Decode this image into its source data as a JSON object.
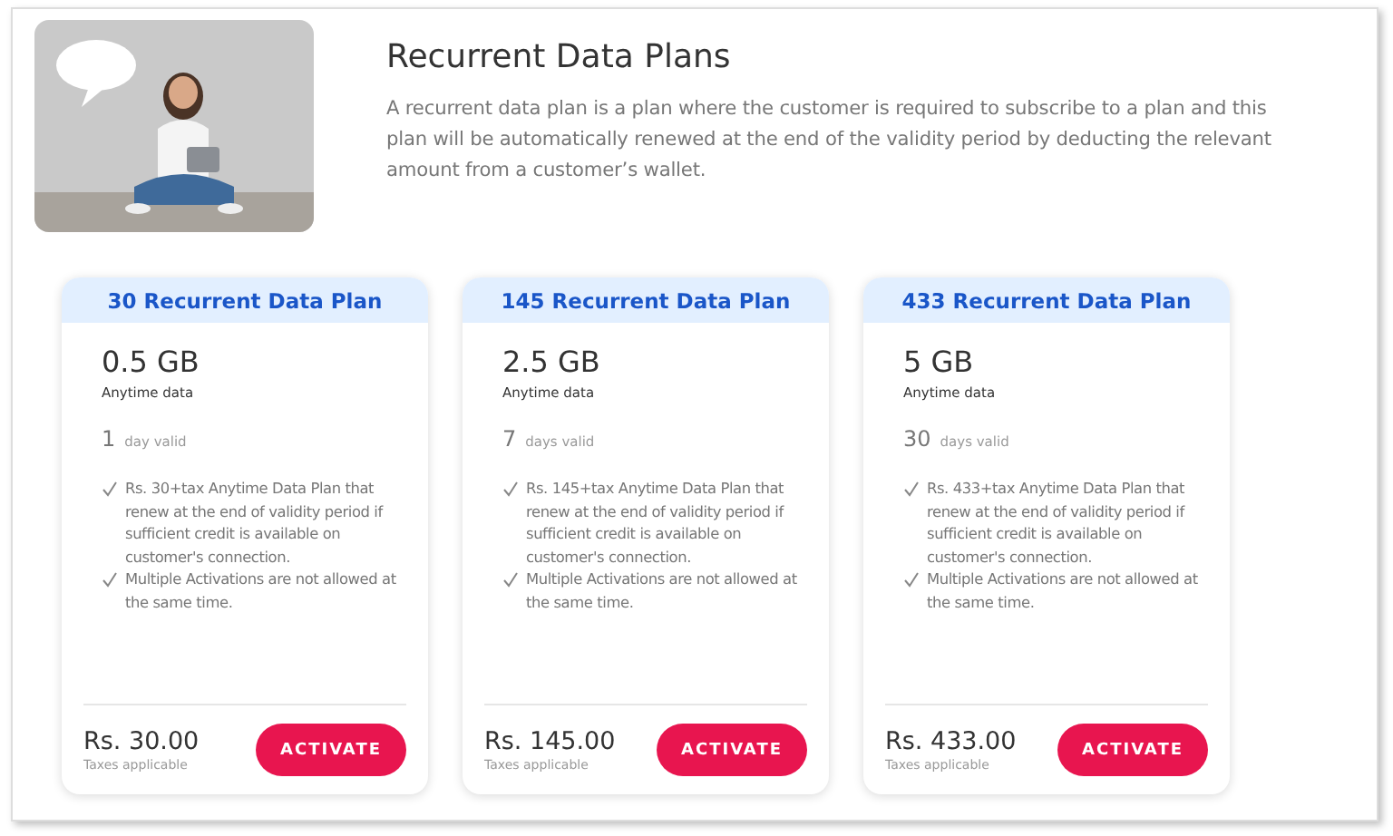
{
  "intro": {
    "title": "Recurrent Data Plans",
    "description": "A recurrent data plan is a plan where the customer is required to subscribe to a plan and this plan will be automatically renewed at the end of the validity period by deducting the relevant amount from a customer’s wallet."
  },
  "plans": [
    {
      "name": "30 Recurrent Data Plan",
      "data": "0.5 GB",
      "data_label": "Anytime data",
      "days": "1",
      "days_label": "day valid",
      "features": [
        "Rs. 30+tax Anytime Data Plan that renew at the end of validity period if sufficient credit is available on customer's connection.",
        "Multiple Activations are not allowed at the same time."
      ],
      "price": "Rs. 30.00",
      "price_note": "Taxes applicable",
      "button": "ACTIVATE"
    },
    {
      "name": "145 Recurrent Data Plan",
      "data": "2.5 GB",
      "data_label": "Anytime data",
      "days": "7",
      "days_label": "days valid",
      "features": [
        "Rs. 145+tax Anytime Data Plan that renew at the end of validity period if sufficient credit is available on customer's connection.",
        "Multiple Activations are not allowed at the same time."
      ],
      "price": "Rs. 145.00",
      "price_note": "Taxes applicable",
      "button": "ACTIVATE"
    },
    {
      "name": "433 Recurrent Data Plan",
      "data": "5 GB",
      "data_label": "Anytime data",
      "days": "30",
      "days_label": "days valid",
      "features": [
        "Rs. 433+tax Anytime Data Plan that renew at the end of validity period if sufficient credit is available on customer's connection.",
        "Multiple Activations are not allowed at the same time."
      ],
      "price": "Rs. 433.00",
      "price_note": "Taxes applicable",
      "button": "ACTIVATE"
    }
  ]
}
